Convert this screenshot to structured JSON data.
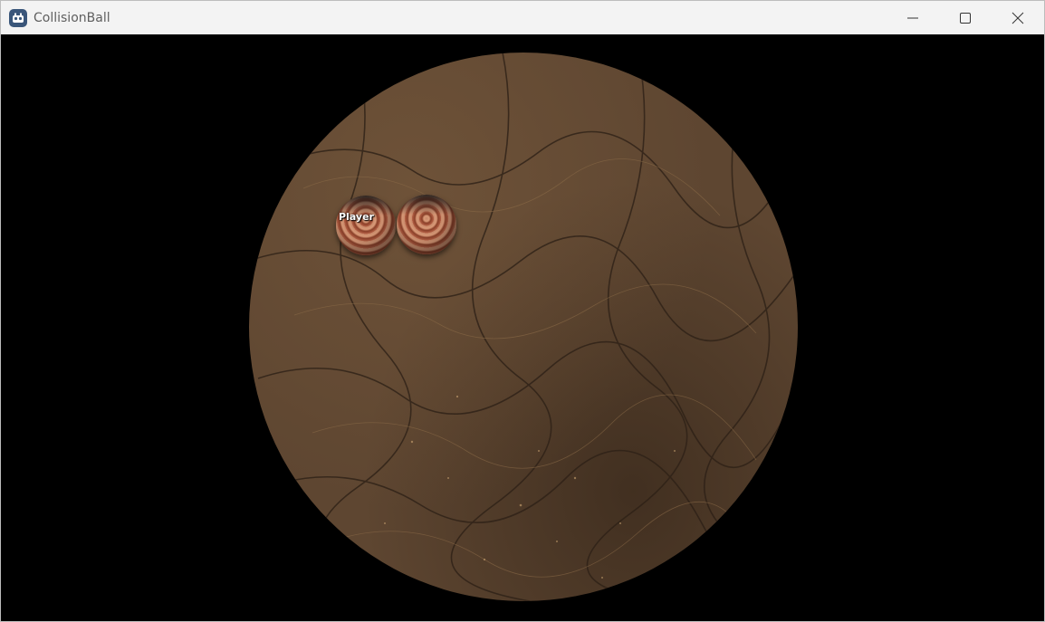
{
  "window": {
    "title": "CollisionBall",
    "app_icon": "godot-engine-icon",
    "controls": [
      "minimize-icon",
      "maximize-icon",
      "close-icon"
    ]
  },
  "game": {
    "arena": "circular-dirt-arena",
    "player_label": "Player",
    "balls": [
      "player-ball",
      "enemy-ball"
    ]
  }
}
